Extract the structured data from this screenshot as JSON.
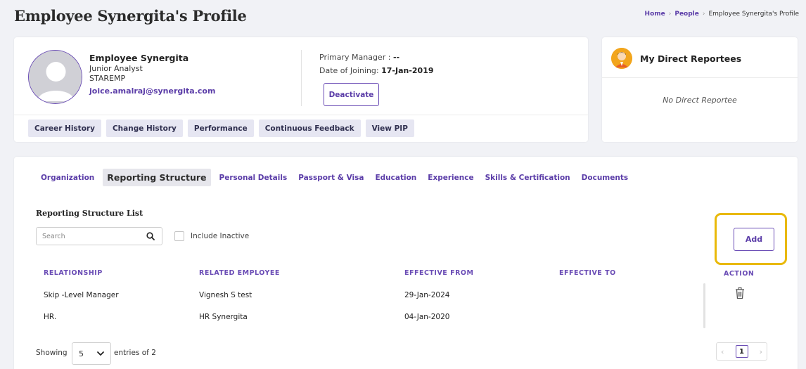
{
  "page": {
    "title": "Employee Synergita's Profile",
    "breadcrumb": [
      "Home",
      "People",
      "Employee Synergita's Profile"
    ]
  },
  "profile": {
    "name": "Employee Synergita",
    "role": "Junior Analyst",
    "code": "STAREMP",
    "email": "joice.amalraj@synergita.com",
    "primary_manager_label": "Primary Manager :",
    "primary_manager_value": "--",
    "doj_label": "Date of Joining:",
    "doj_value": "17-Jan-2019",
    "deactivate_label": "Deactivate",
    "action_tabs": [
      "Career History",
      "Change History",
      "Performance",
      "Continuous Feedback",
      "View PIP"
    ]
  },
  "reportees": {
    "title": "My Direct Reportees",
    "empty_text": "No Direct Reportee"
  },
  "section_tabs": {
    "items": [
      "Organization",
      "Reporting Structure",
      "Personal Details",
      "Passport & Visa",
      "Education",
      "Experience",
      "Skills & Certification",
      "Documents"
    ],
    "active": "Reporting Structure"
  },
  "reporting": {
    "list_title": "Reporting Structure List",
    "search_placeholder": "Search",
    "include_inactive_label": "Include Inactive",
    "include_inactive_checked": false,
    "add_label": "Add",
    "columns": [
      "RELATIONSHIP",
      "RELATED EMPLOYEE",
      "EFFECTIVE FROM",
      "EFFECTIVE TO",
      "ACTION"
    ],
    "rows": [
      {
        "relationship": "Skip -Level Manager",
        "employee": "Vignesh S test",
        "from": "29-Jan-2024",
        "to": ""
      },
      {
        "relationship": "HR.",
        "employee": "HR Synergita",
        "from": "04-Jan-2020",
        "to": ""
      }
    ]
  },
  "pagination": {
    "showing_label": "Showing",
    "page_size": "5",
    "entries_label": "entries of 2",
    "current_page": "1",
    "prev": "‹",
    "next": "›"
  },
  "colors": {
    "accent": "#5b3da8",
    "highlight": "#e9b90a",
    "tab_bg": "#e6e6f2"
  },
  "icons": [
    "search-icon",
    "trash-icon",
    "chevron-down-icon",
    "user-avatar-icon",
    "reportee-icon"
  ]
}
